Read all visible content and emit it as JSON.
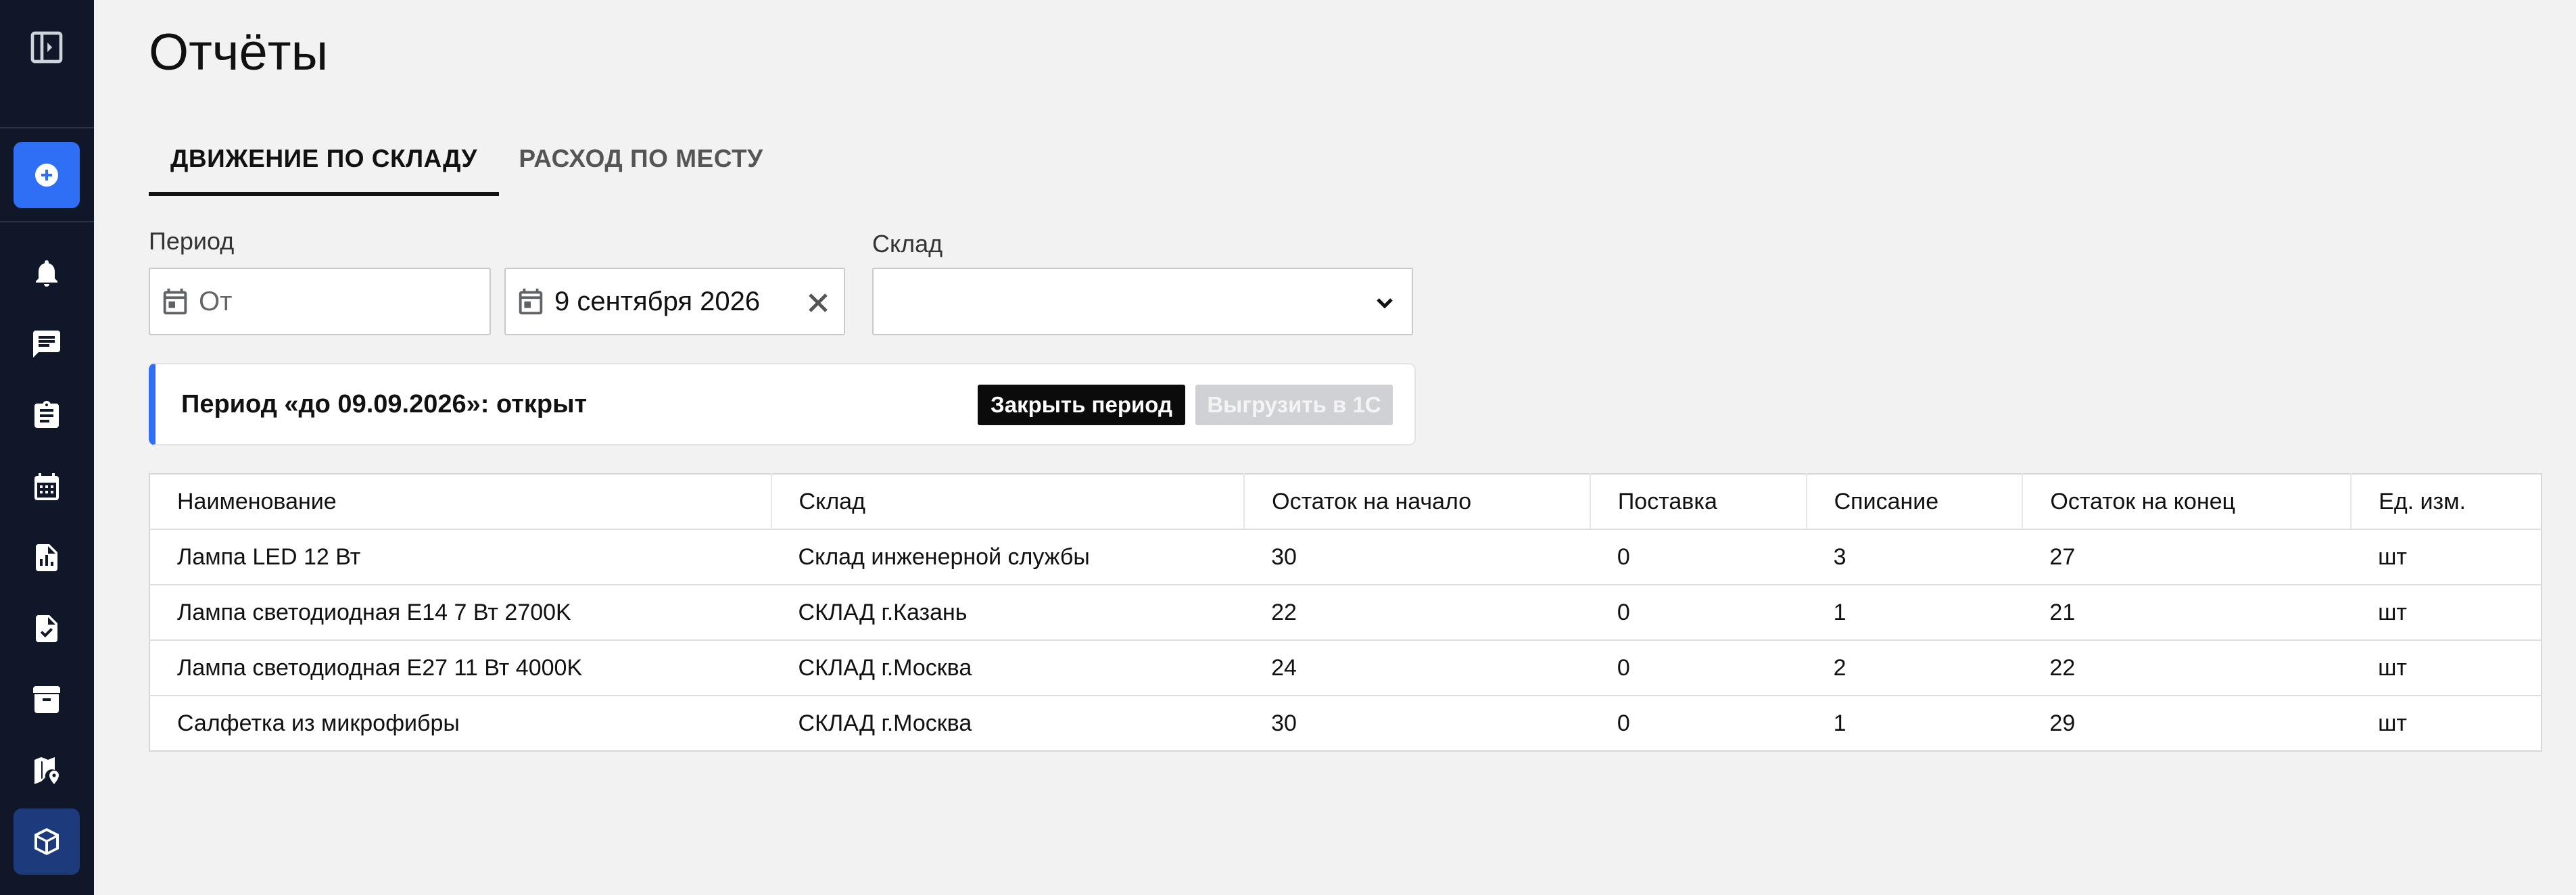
{
  "sidebar": {
    "items": [
      {
        "icon": "sidebar-toggle-icon"
      },
      {
        "icon": "add-icon"
      },
      {
        "icon": "bell-icon"
      },
      {
        "icon": "chat-icon"
      },
      {
        "icon": "clipboard-icon"
      },
      {
        "icon": "calendar-icon"
      },
      {
        "icon": "report-icon"
      },
      {
        "icon": "checklist-icon"
      },
      {
        "icon": "archive-icon"
      },
      {
        "icon": "map-pin-icon"
      },
      {
        "icon": "box-icon"
      }
    ]
  },
  "page": {
    "title": "Отчёты"
  },
  "tabs": [
    {
      "label": "ДВИЖЕНИЕ ПО СКЛАДУ",
      "active": true
    },
    {
      "label": "РАСХОД ПО МЕСТУ",
      "active": false
    }
  ],
  "filters": {
    "period_label": "Период",
    "from_placeholder": "От",
    "to_value": "9 сентября 2026",
    "warehouse_label": "Склад",
    "warehouse_value": ""
  },
  "banner": {
    "text": "Период «до 09.09.2026»: открыт",
    "close_button": "Закрыть период",
    "export_button": "Выгрузить в 1С"
  },
  "table": {
    "headers": [
      "Наименование",
      "Склад",
      "Остаток на начало",
      "Поставка",
      "Списание",
      "Остаток на конец",
      "Ед. изм."
    ],
    "rows": [
      [
        "Лампа LED 12 Вт",
        "Склад инженерной службы",
        "30",
        "0",
        "3",
        "27",
        "шт"
      ],
      [
        "Лампа светодиодная E14 7 Вт 2700K",
        "СКЛАД г.Казань",
        "22",
        "0",
        "1",
        "21",
        "шт"
      ],
      [
        "Лампа светодиодная E27 11 Вт 4000K",
        "СКЛАД г.Москва",
        "24",
        "0",
        "2",
        "22",
        "шт"
      ],
      [
        "Салфетка из микрофибры",
        "СКЛАД г.Москва",
        "30",
        "0",
        "1",
        "29",
        "шт"
      ]
    ]
  },
  "colors": {
    "sidebar_bg": "#0f1729",
    "accent": "#2f6ff6",
    "active_nav": "#1d3a7c"
  }
}
